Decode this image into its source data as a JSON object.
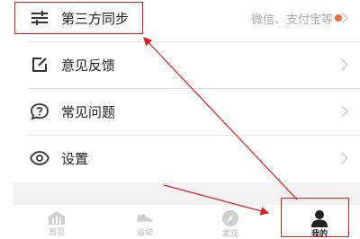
{
  "menu": {
    "items": [
      {
        "label": "第三方同步",
        "sub": "微信、支付宝等",
        "icon": "sliders-icon"
      },
      {
        "label": "意见反馈",
        "icon": "edit-square-icon"
      },
      {
        "label": "常见问题",
        "icon": "question-bubble-icon"
      },
      {
        "label": "设置",
        "icon": "eye-icon"
      }
    ]
  },
  "tabbar": {
    "tabs": [
      {
        "label": "首页",
        "icon": "home-chart-icon"
      },
      {
        "label": "运动",
        "icon": "shoe-icon"
      },
      {
        "label": "发现",
        "icon": "compass-icon"
      },
      {
        "label": "我的",
        "icon": "user-icon"
      }
    ]
  },
  "colors": {
    "annotation": "#e21b1b",
    "badge": "#f26b3a"
  }
}
